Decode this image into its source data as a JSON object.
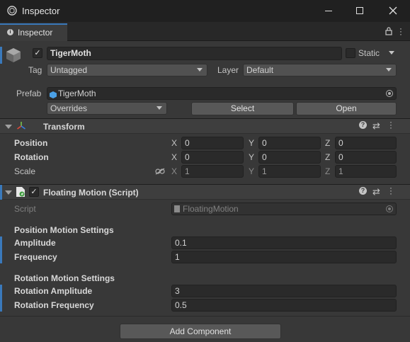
{
  "window": {
    "title": "Inspector"
  },
  "tab": {
    "label": "Inspector"
  },
  "gameobject": {
    "name": "TigerMoth",
    "active": true,
    "static_label": "Static",
    "tag_label": "Tag",
    "tag_value": "Untagged",
    "layer_label": "Layer",
    "layer_value": "Default"
  },
  "prefab": {
    "label": "Prefab",
    "value": "TigerMoth",
    "overrides_label": "Overrides",
    "select_label": "Select",
    "open_label": "Open"
  },
  "transform": {
    "title": "Transform",
    "rows": [
      {
        "label": "Position",
        "x": "0",
        "y": "0",
        "z": "0"
      },
      {
        "label": "Rotation",
        "x": "0",
        "y": "0",
        "z": "0"
      },
      {
        "label": "Scale",
        "x": "1",
        "y": "1",
        "z": "1"
      }
    ],
    "axis_x": "X",
    "axis_y": "Y",
    "axis_z": "Z"
  },
  "script_component": {
    "title": "Floating Motion (Script)",
    "enabled": true,
    "script_label": "Script",
    "script_value": "FloatingMotion",
    "position_section": "Position Motion Settings",
    "amplitude_label": "Amplitude",
    "amplitude_value": "0.1",
    "frequency_label": "Frequency",
    "frequency_value": "1",
    "rotation_section": "Rotation Motion Settings",
    "rot_amplitude_label": "Rotation Amplitude",
    "rot_amplitude_value": "3",
    "rot_frequency_label": "Rotation Frequency",
    "rot_frequency_value": "0.5"
  },
  "add_component_label": "Add Component",
  "colors": {
    "accent": "#3a79bb",
    "background": "#383838",
    "titlebar": "#202020"
  }
}
